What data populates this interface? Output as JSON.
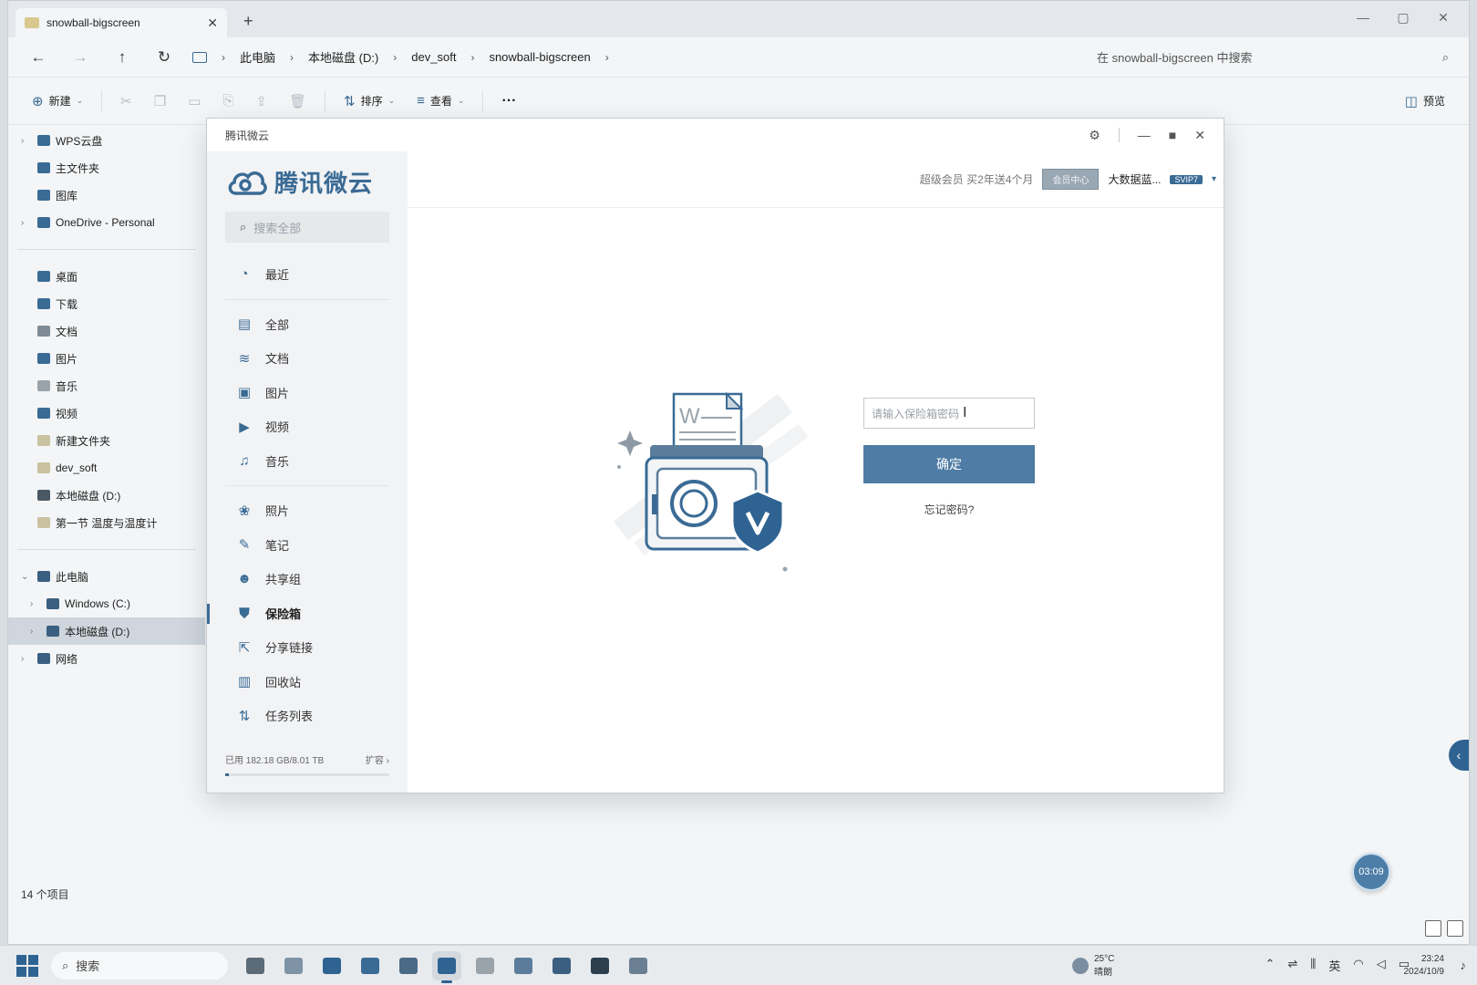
{
  "explorer": {
    "tab_title": "snowball-bigscreen",
    "breadcrumbs": [
      "此电脑",
      "本地磁盘 (D:)",
      "dev_soft",
      "snowball-bigscreen"
    ],
    "search_placeholder": "在 snowball-bigscreen 中搜索",
    "toolbar": {
      "new_label": "新建",
      "sort_label": "排序",
      "view_label": "查看",
      "more_label": "···",
      "preview_label": "预览"
    },
    "nav": [
      {
        "label": "WPS云盘",
        "chev": "›",
        "color": "#3a6b95"
      },
      {
        "label": "主文件夹",
        "chev": "",
        "color": "#3a6b95"
      },
      {
        "label": "图库",
        "chev": "",
        "color": "#3a6b95"
      },
      {
        "label": "OneDrive - Personal",
        "chev": "›",
        "color": "#3a6b95"
      }
    ],
    "quick_access": [
      {
        "label": "桌面",
        "color": "#3a6b95"
      },
      {
        "label": "下载",
        "color": "#3a6b95"
      },
      {
        "label": "文档",
        "color": "#7f8b96"
      },
      {
        "label": "图片",
        "color": "#3a6b95"
      },
      {
        "label": "音乐",
        "color": "#9aa2aa"
      },
      {
        "label": "视频",
        "color": "#3a6b95"
      },
      {
        "label": "新建文件夹",
        "color": "#c9c2a0"
      },
      {
        "label": "dev_soft",
        "color": "#c9c2a0"
      },
      {
        "label": "本地磁盘 (D:)",
        "color": "#4a5965"
      },
      {
        "label": "第一节 温度与温度计",
        "color": "#c9c2a0"
      }
    ],
    "tree": [
      {
        "label": "此电脑",
        "chev": "⌄",
        "indent": 0
      },
      {
        "label": "Windows (C:)",
        "chev": "›",
        "indent": 1
      },
      {
        "label": "本地磁盘 (D:)",
        "chev": "›",
        "indent": 1,
        "selected": true
      },
      {
        "label": "网络",
        "chev": "›",
        "indent": 0
      }
    ],
    "status": "14 个项目",
    "timer": "03:09"
  },
  "weiyun": {
    "window_title": "腾讯微云",
    "logo_text": "腾讯微云",
    "search_placeholder": "搜索全部",
    "menu_recent": {
      "label": "最近",
      "icon": "◔"
    },
    "menu_group1": [
      {
        "label": "全部",
        "icon": "▤"
      },
      {
        "label": "文档",
        "icon": "≋"
      },
      {
        "label": "图片",
        "icon": "▣"
      },
      {
        "label": "视频",
        "icon": "▶"
      },
      {
        "label": "音乐",
        "icon": "♫"
      }
    ],
    "menu_group2": [
      {
        "label": "照片",
        "icon": "❀"
      },
      {
        "label": "笔记",
        "icon": "✎"
      },
      {
        "label": "共享组",
        "icon": "☻"
      },
      {
        "label": "保险箱",
        "icon": "⛊",
        "active": true
      },
      {
        "label": "分享链接",
        "icon": "⇱"
      },
      {
        "label": "回收站",
        "icon": "▥"
      },
      {
        "label": "任务列表",
        "icon": "⇅"
      }
    ],
    "usage_text": "已用 182.18 GB/8.01 TB",
    "expand_label": "扩容 ›",
    "usage_fraction": 0.022,
    "vip_promo": "超级会员 买2年送4个月",
    "member_center": "会员中心",
    "username": "大数据蓝...",
    "svip_badge": "SVIP7",
    "password_placeholder": "请输入保险箱密码",
    "confirm_label": "确定",
    "forgot_label": "忘记密码?"
  },
  "taskbar": {
    "search_label": "搜索",
    "apps": [
      {
        "name": "file-manager-app",
        "color": "#5b6b78"
      },
      {
        "name": "folder-app",
        "color": "#7f93a6"
      },
      {
        "name": "edge-app",
        "color": "#2f6392"
      },
      {
        "name": "pinned-app",
        "color": "#3a6b95"
      },
      {
        "name": "screenshot-app",
        "color": "#4a6a86"
      },
      {
        "name": "weiyun-app",
        "color": "#2f6392",
        "active": true
      },
      {
        "name": "browser-app",
        "color": "#9aa2aa"
      },
      {
        "name": "editor-app",
        "color": "#5b7d9b"
      },
      {
        "name": "teams-app",
        "color": "#3a5f80"
      },
      {
        "name": "terminal-app",
        "color": "#2d3e4d"
      },
      {
        "name": "chatgpt-app",
        "color": "#6a7f92"
      }
    ],
    "weather_temp": "25°C",
    "weather_desc": "晴朗",
    "tray_lang": "英",
    "time": "23:24",
    "date": "2024/10/9"
  }
}
